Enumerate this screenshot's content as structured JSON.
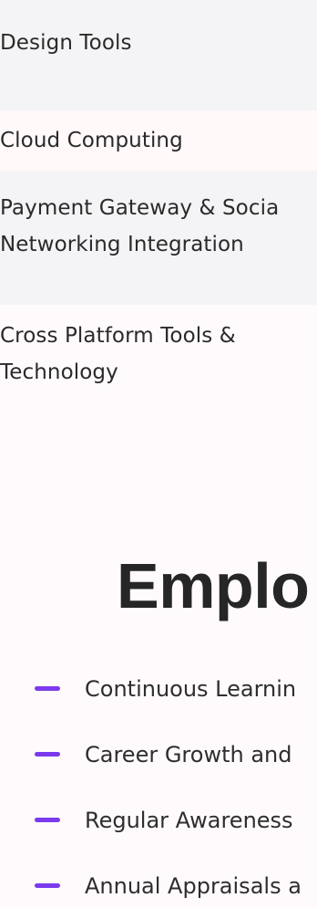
{
  "tech_stack": [
    {
      "lines": [
        "Design Tools"
      ]
    },
    {
      "lines": [
        "Cloud Computing"
      ]
    },
    {
      "lines": [
        "Payment Gateway & Socia",
        "Networking Integration"
      ]
    },
    {
      "lines": [
        "Cross Platform Tools &",
        "Technology"
      ]
    }
  ],
  "section_title": "Emplo",
  "benefits": [
    "Continuous Learnin",
    "Career Growth and",
    "Regular Awareness",
    "Annual Appraisals a"
  ],
  "colors": {
    "accent": "#7b3aed",
    "row_gray": "#f4f4f6",
    "row_white": "#fffbfc",
    "text": "#2a2a2a"
  },
  "icons": {
    "bullet": "dash-icon"
  }
}
